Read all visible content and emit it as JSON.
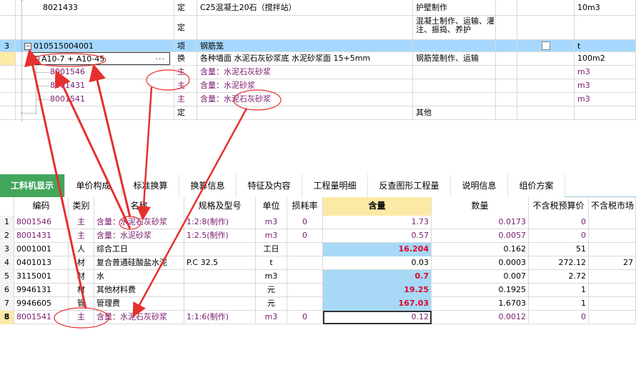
{
  "top_rows": [
    {
      "code": "8021433",
      "type": "定",
      "name": "C25混凝土20石（搅拌站）",
      "work": "护壁制作",
      "unit": "10m3"
    },
    {
      "code": "",
      "type": "定",
      "name": "",
      "work": "混凝土制作、运输、灌注、振捣、养护",
      "unit": ""
    },
    {
      "rownum": "3",
      "code": "010515004001",
      "type": "项",
      "name": "钢筋笼",
      "work": "",
      "unit": "t"
    },
    {
      "code": "A10-7 + A10-45",
      "ellipsis": "···",
      "type": "换",
      "name": "各种墙面 水泥石灰砂浆底 水泥砂浆面 15+5mm",
      "work": "钢筋笼制作、运输",
      "unit": "100m2"
    },
    {
      "code": "8001546",
      "type": "主",
      "name": "含量：水泥石灰砂浆",
      "work": "",
      "unit": "m3"
    },
    {
      "code": "8001431",
      "type": "主",
      "name": "含量：水泥砂浆",
      "work": "",
      "unit": "m3"
    },
    {
      "code": "8001541",
      "type": "主",
      "name": "含量：水泥石灰砂浆",
      "work": "",
      "unit": "m3"
    },
    {
      "code": "",
      "type": "定",
      "name": "",
      "work": "其他",
      "unit": ""
    }
  ],
  "tabs": [
    {
      "label": "工料机显示",
      "active": true
    },
    {
      "label": "单价构成"
    },
    {
      "label": "标准换算"
    },
    {
      "label": "换算信息"
    },
    {
      "label": "特征及内容"
    },
    {
      "label": "工程量明细"
    },
    {
      "label": "反查图形工程量"
    },
    {
      "label": "说明信息"
    },
    {
      "label": "组价方案"
    }
  ],
  "bottom_headers": {
    "code": "编码",
    "type": "类别",
    "name": "名称",
    "spec": "规格及型号",
    "unit": "单位",
    "loss": "损耗率",
    "content": "含量",
    "qty": "数量",
    "budget": "不含税预算价",
    "market": "不含税市场"
  },
  "bottom_rows": [
    {
      "n": "1",
      "code": "8001546",
      "type": "主",
      "name": "含量：水泥石灰砂浆",
      "spec": "1:2:8(制作)",
      "unit": "m3",
      "loss": "0",
      "content": "1.73",
      "qty": "0.0173",
      "budget": "0",
      "market": ""
    },
    {
      "n": "2",
      "code": "8001431",
      "type": "主",
      "name": "含量：水泥砂浆",
      "spec": "1:2.5(制作)",
      "unit": "m3",
      "loss": "0",
      "content": "0.57",
      "qty": "0.0057",
      "budget": "0",
      "market": ""
    },
    {
      "n": "3",
      "code": "0001001",
      "type": "人",
      "name": "综合工日",
      "spec": "",
      "unit": "工日",
      "loss": "",
      "content": "16.204",
      "qty": "0.162",
      "budget": "51",
      "market": ""
    },
    {
      "n": "4",
      "code": "0401013",
      "type": "材",
      "name": "复合普通硅酸盐水泥",
      "spec": "P.C 32.5",
      "unit": "t",
      "loss": "",
      "content": "0.03",
      "qty": "0.0003",
      "budget": "272.12",
      "market": "27"
    },
    {
      "n": "5",
      "code": "3115001",
      "type": "材",
      "name": "水",
      "spec": "",
      "unit": "m3",
      "loss": "",
      "content": "0.7",
      "qty": "0.007",
      "budget": "2.72",
      "market": ""
    },
    {
      "n": "6",
      "code": "9946131",
      "type": "材",
      "name": "其他材料费",
      "spec": "",
      "unit": "元",
      "loss": "",
      "content": "19.25",
      "qty": "0.1925",
      "budget": "1",
      "market": ""
    },
    {
      "n": "7",
      "code": "9946605",
      "type": "管",
      "name": "管理费",
      "spec": "",
      "unit": "元",
      "loss": "",
      "content": "167.03",
      "qty": "1.6703",
      "budget": "1",
      "market": ""
    },
    {
      "n": "8",
      "code": "8001541",
      "type": "主",
      "name": "含量：水泥石灰砂浆",
      "spec": "1:1:6(制作)",
      "unit": "m3",
      "loss": "0",
      "content": "0.12",
      "qty": "0.0012",
      "budget": "0",
      "market": ""
    }
  ],
  "colors": {
    "tab_active": "#41a65a",
    "selected_row": "#a6d8ff",
    "purple_text": "#7a1a6e",
    "content_highlight": "#a7d9f7",
    "annotation_red": "#e53030"
  }
}
